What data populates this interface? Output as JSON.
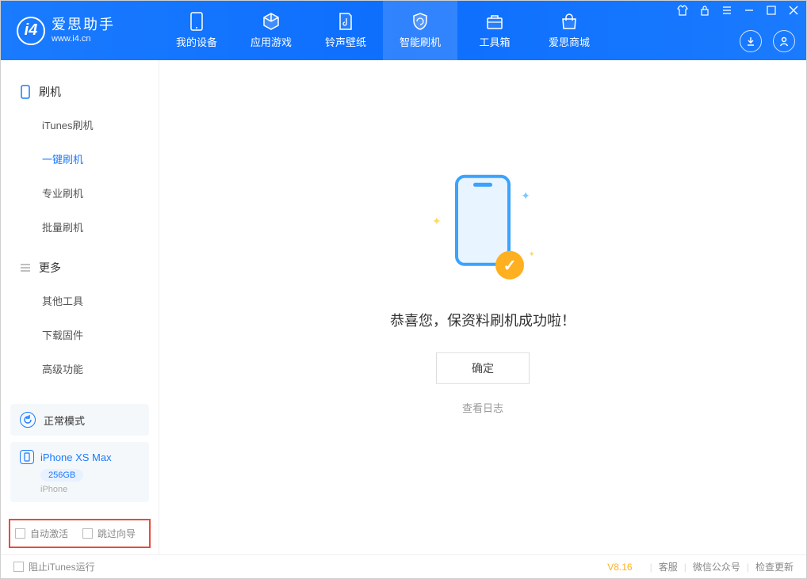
{
  "header": {
    "logo_title": "爱思助手",
    "logo_sub": "www.i4.cn",
    "tabs": [
      {
        "label": "我的设备"
      },
      {
        "label": "应用游戏"
      },
      {
        "label": "铃声壁纸"
      },
      {
        "label": "智能刷机"
      },
      {
        "label": "工具箱"
      },
      {
        "label": "爱思商城"
      }
    ]
  },
  "sidebar": {
    "group1": {
      "title": "刷机",
      "items": [
        "iTunes刷机",
        "一键刷机",
        "专业刷机",
        "批量刷机"
      ]
    },
    "group2": {
      "title": "更多",
      "items": [
        "其他工具",
        "下载固件",
        "高级功能"
      ]
    },
    "mode_label": "正常模式",
    "device_name": "iPhone XS Max",
    "device_storage": "256GB",
    "device_type": "iPhone",
    "checkbox1": "自动激活",
    "checkbox2": "跳过向导"
  },
  "content": {
    "success_title": "恭喜您，保资料刷机成功啦！",
    "ok_button": "确定",
    "log_link": "查看日志"
  },
  "footer": {
    "block_itunes": "阻止iTunes运行",
    "version": "V8.16",
    "links": [
      "客服",
      "微信公众号",
      "检查更新"
    ]
  }
}
